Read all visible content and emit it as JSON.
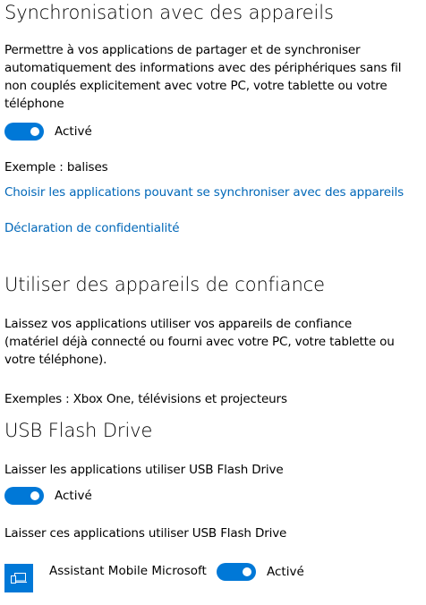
{
  "sync_section": {
    "title": "Synchronisation avec des appareils",
    "description": "Permettre à vos applications de partager et de synchroniser automatiquement des informations avec des périphériques sans fil non couplés explicitement avec votre PC, votre tablette ou votre téléphone",
    "toggle": {
      "state": "on",
      "label": "Activé"
    },
    "example": "Exemple : balises",
    "choose_apps_link": "Choisir les applications pouvant se synchroniser avec des appareils",
    "privacy_link": "Déclaration de confidentialité"
  },
  "trusted_section": {
    "title": "Utiliser des appareils de confiance",
    "description": "Laissez vos applications utiliser vos appareils de confiance (matériel déjà connecté ou fourni avec votre PC, votre tablette ou votre téléphone).",
    "examples": "Exemples : Xbox One, télévisions et projecteurs"
  },
  "usb_section": {
    "title": "USB Flash Drive",
    "allow_label": "Laisser les applications utiliser USB Flash Drive",
    "toggle": {
      "state": "on",
      "label": "Activé"
    },
    "apps_label": "Laisser ces applications utiliser USB Flash Drive",
    "apps": [
      {
        "name": "Assistant Mobile Microsoft",
        "icon": "phone-laptop-icon",
        "toggle": {
          "state": "on",
          "label": "Activé"
        }
      }
    ]
  },
  "colors": {
    "accent": "#0078d7",
    "link": "#0067b8"
  }
}
